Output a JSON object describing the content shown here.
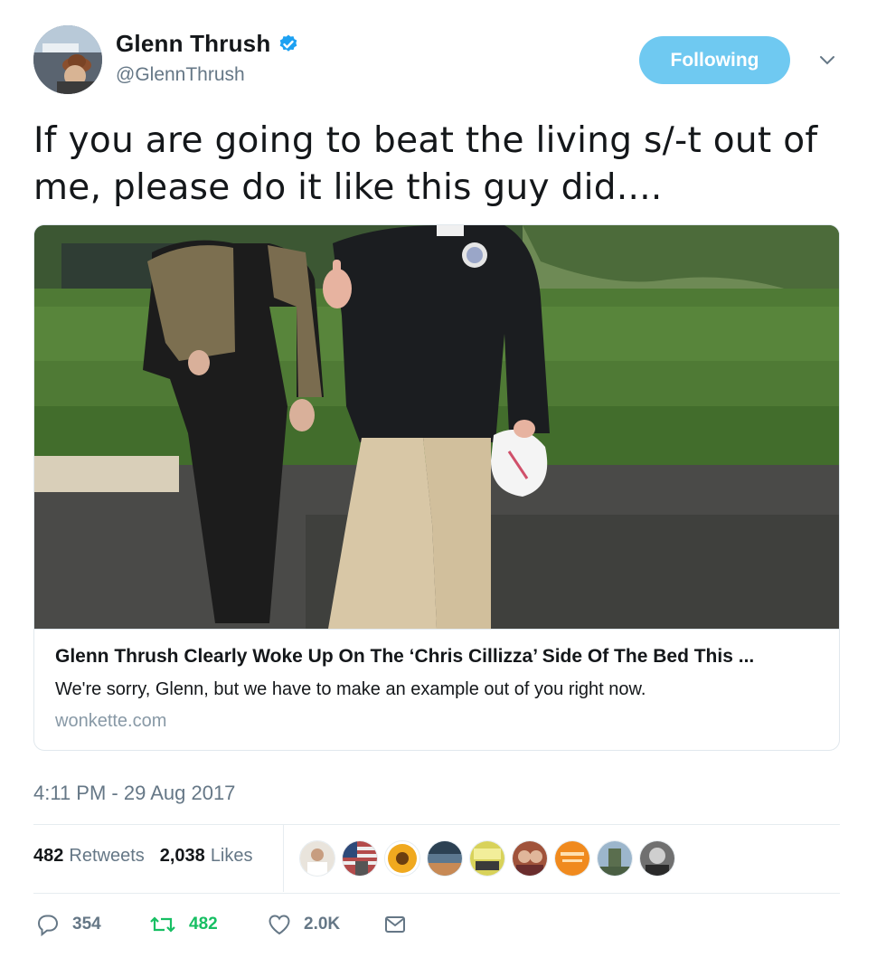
{
  "user": {
    "display_name": "Glenn Thrush",
    "handle": "@GlennThrush",
    "verified": true
  },
  "follow_button_label": "Following",
  "tweet_text": "If you are going to beat the living s/-t out of me, please do it like this guy did....",
  "card": {
    "title": "Glenn Thrush Clearly Woke Up On The ‘Chris Cillizza’ Side Of The Bed This ...",
    "description": "We're sorry, Glenn, but we have to make an example out of you right now.",
    "domain": "wonkette.com"
  },
  "timestamp": "4:11 PM - 29 Aug 2017",
  "stats": {
    "retweets_count": "482",
    "retweets_label": "Retweets",
    "likes_count": "2,038",
    "likes_label": "Likes"
  },
  "actions": {
    "reply_count": "354",
    "retweet_count": "482",
    "like_count": "2.0K"
  },
  "colors": {
    "accent": "#1da1f2",
    "follow_button_bg": "#6fc9f1",
    "retweet_active": "#17bf63",
    "muted_text": "#657786"
  },
  "icons": {
    "verified": "verified-badge-icon",
    "caret": "chevron-down-icon",
    "reply": "reply-icon",
    "retweet": "retweet-icon",
    "like": "heart-icon",
    "dm": "envelope-icon"
  }
}
